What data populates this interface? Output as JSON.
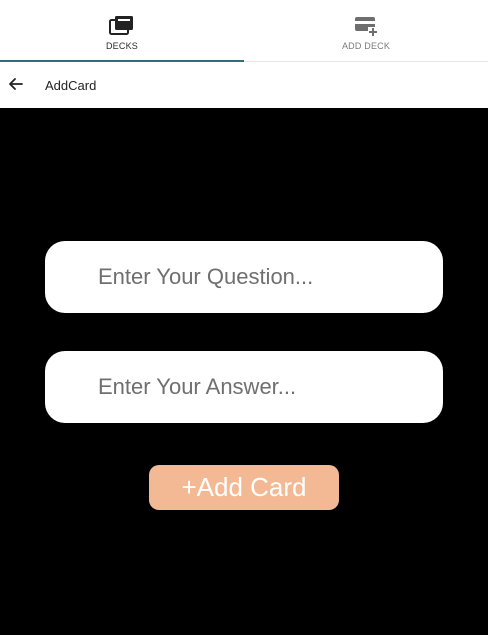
{
  "tabs": {
    "decks": {
      "label": "DECKS",
      "icon": "decks-icon",
      "active": true
    },
    "add_deck": {
      "label": "ADD DECK",
      "icon": "add-deck-icon",
      "active": false
    }
  },
  "header": {
    "title": "AddCard",
    "back_icon": "back-arrow-icon"
  },
  "form": {
    "question_placeholder": "Enter Your Question...",
    "answer_placeholder": "Enter Your Answer...",
    "add_label": "+Add Card"
  },
  "colors": {
    "accent_underline": "#2f6f7a",
    "button_bg": "#f3b994",
    "background": "#000000"
  }
}
